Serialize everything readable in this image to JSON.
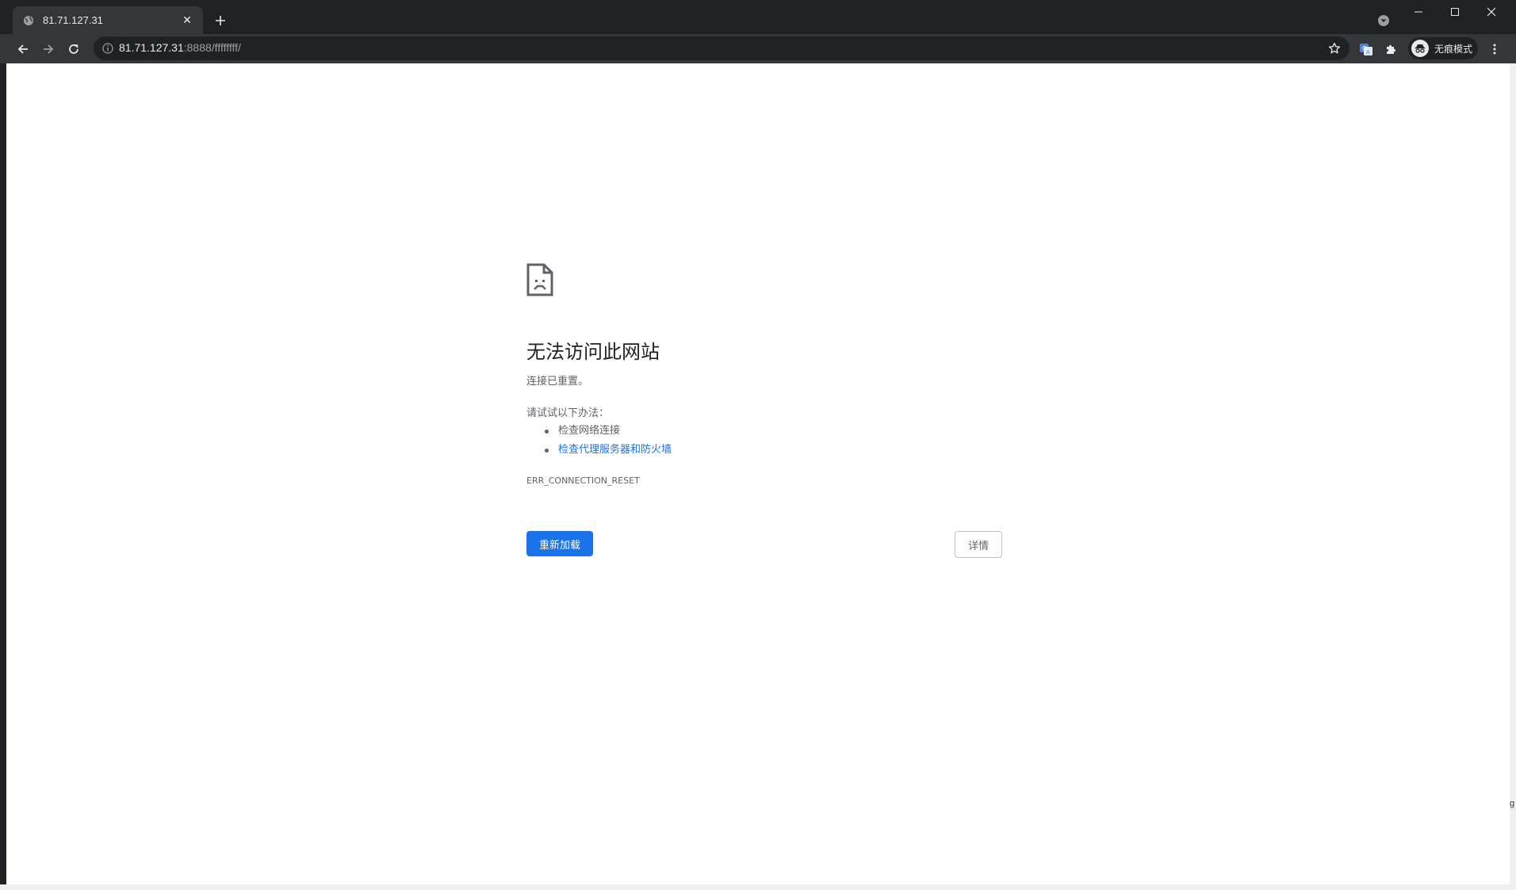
{
  "browser": {
    "tab": {
      "title": "81.71.127.31",
      "favicon": "globe-icon",
      "close_glyph": "✕"
    },
    "new_tab_glyph": "+",
    "omnibox": {
      "host": "81.71.127.31",
      "path": ":8888/ffffffff/"
    },
    "profile": {
      "label": "无痕模式",
      "icon": "incognito-icon"
    }
  },
  "page": {
    "headline": "无法访问此网站",
    "subtext": "连接已重置。",
    "suggestions_title": "请试试以下办法：",
    "suggestions": [
      {
        "text": "检查网络连接",
        "is_link": false
      },
      {
        "text": "检查代理服务器和防火墙",
        "is_link": true
      }
    ],
    "error_code": "ERR_CONNECTION_RESET",
    "reload_button": "重新加载",
    "details_button": "详情"
  },
  "edge_glyph": "g"
}
